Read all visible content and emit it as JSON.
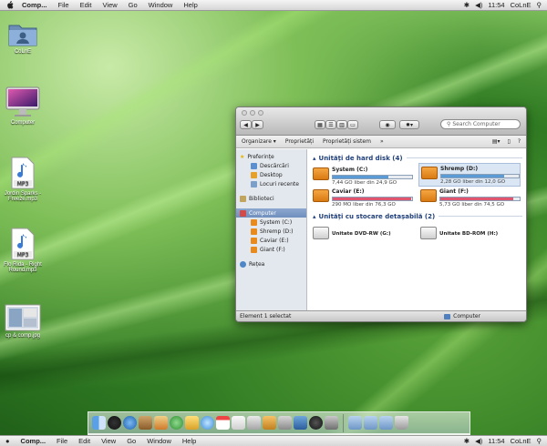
{
  "menubar": {
    "app": "Comp...",
    "items": [
      "File",
      "Edit",
      "View",
      "Go",
      "Window",
      "Help"
    ],
    "clock": "11:54",
    "user": "CoLnE"
  },
  "bottom_menubar": {
    "app": "Comp...",
    "items": [
      "File",
      "Edit",
      "View",
      "Go",
      "Window",
      "Help"
    ],
    "clock": "11:54",
    "user": "CoLnE"
  },
  "desktop": {
    "icons": [
      {
        "label": "CoLnE",
        "icon": "user-folder-icon"
      },
      {
        "label": "Computer",
        "icon": "imac-icon"
      },
      {
        "label": "Jordin Sparks - Freeze.mp3",
        "icon": "mp3-file-icon"
      },
      {
        "label": "Flo Rida - Right Round.mp3",
        "icon": "mp3-file-icon"
      },
      {
        "label": "cp & comp.jpg",
        "icon": "image-file-icon"
      }
    ]
  },
  "window": {
    "search_placeholder": "Search Computer",
    "commands": [
      "Organizare ▾",
      "Proprietăți",
      "Proprietăți sistem",
      "»"
    ],
    "sidebar": {
      "favorites_label": "Preferințe",
      "favorites": [
        "Descărcări",
        "Desktop",
        "Locuri recente"
      ],
      "libraries": "Biblioteci",
      "computer": "Computer",
      "drives": [
        "System (C:)",
        "Shremp (D:)",
        "Caviar (E:)",
        "Giant (F:)"
      ],
      "network": "Rețea"
    },
    "hard_disks": {
      "title": "Unități de hard disk (4)",
      "drives": [
        {
          "name": "System (C:)",
          "free": "7,44 GO liber din 24,9 GO",
          "used_fraction": 0.7,
          "bar": "#5b9bd5"
        },
        {
          "name": "Shremp (D:)",
          "free": "2,28 GO liber din 12,0 GO",
          "used_fraction": 0.81,
          "bar": "#5b9bd5"
        },
        {
          "name": "Caviar (E:)",
          "free": "290 MO liber din 76,3 GO",
          "used_fraction": 0.99,
          "bar": "#e0566e"
        },
        {
          "name": "Giant (F:)",
          "free": "5,73 GO liber din 74,5 GO",
          "used_fraction": 0.92,
          "bar": "#e0566e"
        }
      ]
    },
    "removable": {
      "title": "Unități cu stocare detașabilă (2)",
      "drives": [
        {
          "name": "Unitate DVD-RW (G:)"
        },
        {
          "name": "Unitate BD-ROM (H:)"
        }
      ]
    },
    "status": {
      "left": "Element 1 selectat",
      "right": "Computer"
    }
  },
  "colors": {
    "drive_orange": "#e88a1c",
    "group_title": "#1f3f7a",
    "selection": "#7a97c4"
  }
}
